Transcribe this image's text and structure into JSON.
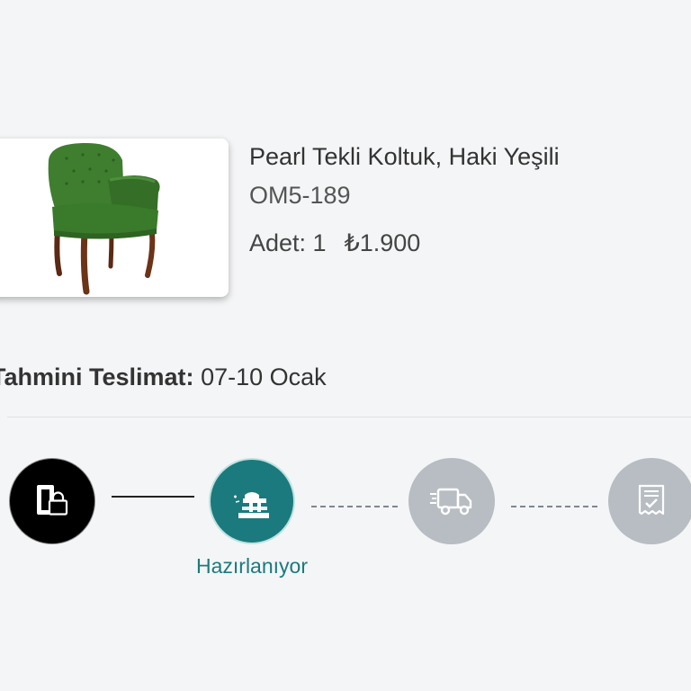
{
  "product": {
    "name": "Pearl Tekli Koltuk, Haki Yeşili",
    "sku": "OM5-189",
    "quantity_label": "Adet: 1",
    "price": "₺1.900",
    "image": "armchair-image"
  },
  "delivery": {
    "label": "Tahmini Teslimat:",
    "value": "07-10 Ocak"
  },
  "steps": [
    {
      "icon": "order-confirmed-icon",
      "state": "completed"
    },
    {
      "icon": "preparing-icon",
      "state": "active",
      "label": "Hazırlanıyor"
    },
    {
      "icon": "shipping-truck-icon",
      "state": "pending"
    },
    {
      "icon": "invoice-delivered-icon",
      "state": "pending"
    }
  ],
  "colors": {
    "background": "#f4f5f6",
    "active": "#1b7a7d",
    "completed": "#000000",
    "pending": "#b7bdc2",
    "chair": "#3e7d2e"
  }
}
